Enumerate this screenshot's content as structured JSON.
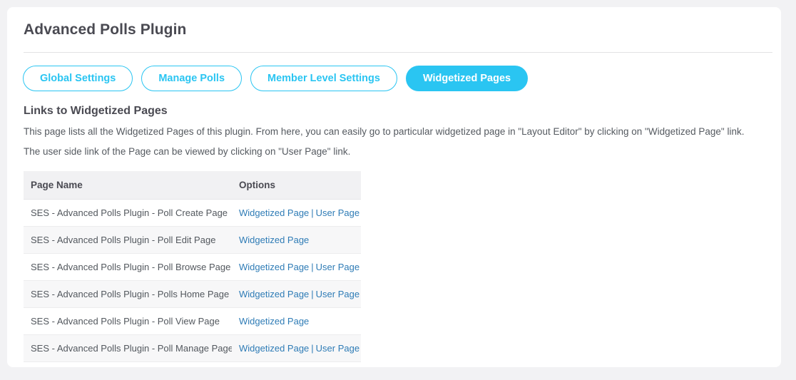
{
  "header": {
    "title": "Advanced Polls Plugin"
  },
  "tabs": [
    {
      "label": "Global Settings",
      "active": false
    },
    {
      "label": "Manage Polls",
      "active": false
    },
    {
      "label": "Member Level Settings",
      "active": false
    },
    {
      "label": "Widgetized Pages",
      "active": true
    }
  ],
  "section": {
    "heading": "Links to Widgetized Pages",
    "description_line_1": "This page lists all the Widgetized Pages of this plugin. From here, you can easily go to particular widgetized page in \"Layout Editor\" by clicking on \"Widgetized Page\" link.",
    "description_line_2": "The user side link of the Page can be viewed by clicking on \"User Page\" link."
  },
  "table": {
    "columns": [
      "Page Name",
      "Options"
    ],
    "link_separator": "|",
    "rows": [
      {
        "page_name": "SES - Advanced Polls Plugin - Poll Create Page",
        "options": [
          "Widgetized Page",
          "User Page"
        ]
      },
      {
        "page_name": "SES - Advanced Polls Plugin - Poll Edit Page",
        "options": [
          "Widgetized Page"
        ]
      },
      {
        "page_name": "SES - Advanced Polls Plugin - Poll Browse Page",
        "options": [
          "Widgetized Page",
          "User Page"
        ]
      },
      {
        "page_name": "SES - Advanced Polls Plugin - Polls Home Page",
        "options": [
          "Widgetized Page",
          "User Page"
        ]
      },
      {
        "page_name": "SES - Advanced Polls Plugin - Poll View Page",
        "options": [
          "Widgetized Page"
        ]
      },
      {
        "page_name": "SES - Advanced Polls Plugin - Poll Manage Page",
        "options": [
          "Widgetized Page",
          "User Page"
        ]
      }
    ]
  },
  "colors": {
    "accent": "#2ac5f2",
    "link": "#2f7cb6",
    "text": "#4a4a52",
    "page_background": "#f2f2f4",
    "card_background": "#ffffff",
    "row_stripe": "#f7f7f8",
    "header_row": "#f1f1f3"
  }
}
